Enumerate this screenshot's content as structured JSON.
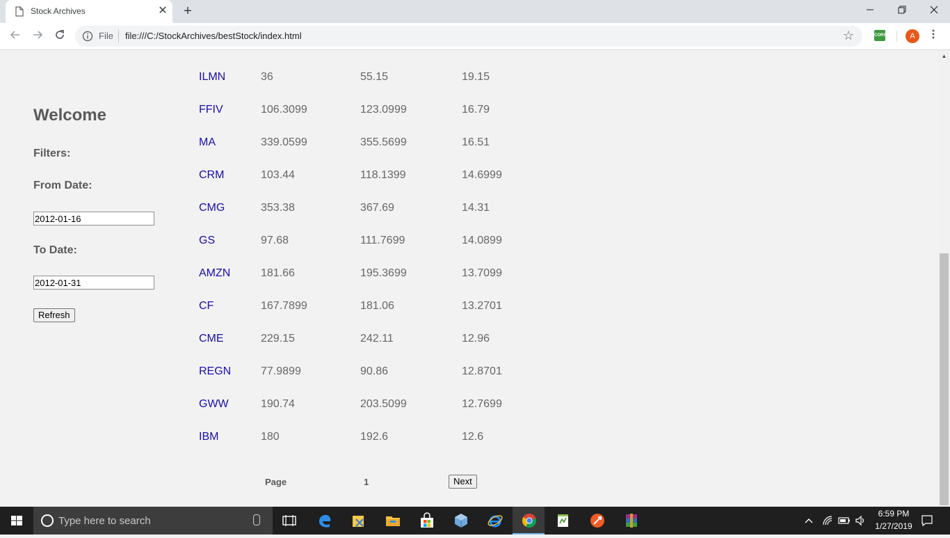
{
  "browser": {
    "tab_title": "Stock Archives",
    "tab_close": "✕",
    "new_tab": "+",
    "scheme_label": "File",
    "url": "file:///C:/StockArchives/bestStock/index.html",
    "ext_label": "CORS",
    "avatar_letter": "A"
  },
  "sidebar": {
    "title": "Welcome",
    "filters_label": "Filters:",
    "from_label": "From Date:",
    "from_value": "2012-01-16",
    "to_label": "To Date:",
    "to_value": "2012-01-31",
    "refresh_label": "Refresh"
  },
  "table": {
    "rows": [
      {
        "symbol": "ILMN",
        "a": "36",
        "b": "55.15",
        "c": "19.15"
      },
      {
        "symbol": "FFIV",
        "a": "106.3099",
        "b": "123.0999",
        "c": "16.79"
      },
      {
        "symbol": "MA",
        "a": "339.0599",
        "b": "355.5699",
        "c": "16.51"
      },
      {
        "symbol": "CRM",
        "a": "103.44",
        "b": "118.1399",
        "c": "14.6999"
      },
      {
        "symbol": "CMG",
        "a": "353.38",
        "b": "367.69",
        "c": "14.31"
      },
      {
        "symbol": "GS",
        "a": "97.68",
        "b": "111.7699",
        "c": "14.0899"
      },
      {
        "symbol": "AMZN",
        "a": "181.66",
        "b": "195.3699",
        "c": "13.7099"
      },
      {
        "symbol": "CF",
        "a": "167.7899",
        "b": "181.06",
        "c": "13.2701"
      },
      {
        "symbol": "CME",
        "a": "229.15",
        "b": "242.11",
        "c": "12.96"
      },
      {
        "symbol": "REGN",
        "a": "77.9899",
        "b": "90.86",
        "c": "12.8701"
      },
      {
        "symbol": "GWW",
        "a": "190.74",
        "b": "203.5099",
        "c": "12.7699"
      },
      {
        "symbol": "IBM",
        "a": "180",
        "b": "192.6",
        "c": "12.6"
      }
    ]
  },
  "pager": {
    "label": "Page",
    "number": "1",
    "next_label": "Next"
  },
  "taskbar": {
    "search_placeholder": "Type here to search",
    "time": "6:59 PM",
    "date": "1/27/2019"
  },
  "colors": {
    "link": "#1a0dab",
    "text": "#666666",
    "page_bg": "#f2f2f2",
    "taskbar_bg": "#1f1f1f"
  }
}
